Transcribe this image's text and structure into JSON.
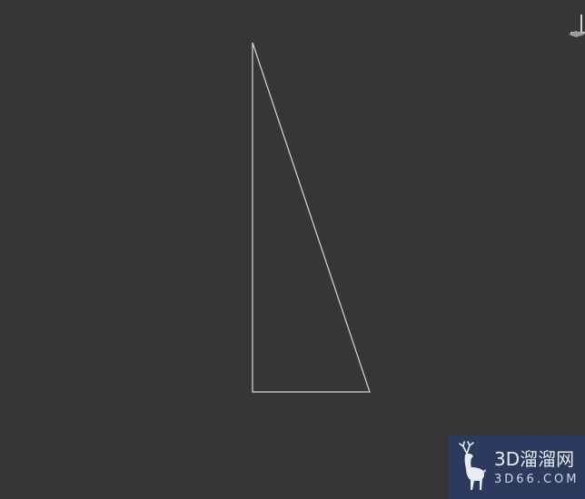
{
  "viewport": {
    "background": "#363636",
    "shape_stroke": "#d8d8d8",
    "shape": "triangle"
  },
  "gizmo": {
    "icon": "axis-gizmo-icon"
  },
  "watermark": {
    "logo_icon": "deer-logo-icon",
    "title": "3D溜溜网",
    "subtitle": "3D66.COM",
    "background": "#2c3a5e"
  }
}
